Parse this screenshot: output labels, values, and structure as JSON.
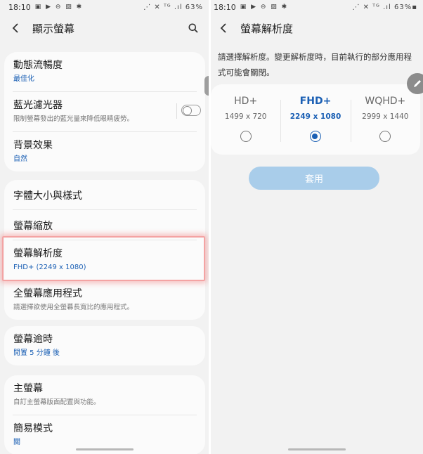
{
  "left": {
    "status": {
      "time": "18:10",
      "icons": "▣ ▶ ⊖ ▨ ✱",
      "right": "⋰ ✕ ᵀᴳ .ıl 63%"
    },
    "title": "顯示螢幕",
    "groups": [
      {
        "items": [
          {
            "title": "動態流暢度",
            "subtitle": "最佳化"
          },
          {
            "title": "藍光濾光器",
            "subtitle": "限制螢幕發出的藍光量來降低眼睛疲勞。"
          },
          {
            "title": "背景效果",
            "subtitle": "自然"
          }
        ]
      },
      {
        "items": [
          {
            "title": "字體大小與樣式"
          },
          {
            "title": "螢幕縮放"
          },
          {
            "title": "螢幕解析度",
            "subtitle": "FHD+ (2249 x 1080)"
          },
          {
            "title": "全螢幕應用程式",
            "subtitle": "請選擇欲使用全螢幕長寬比的應用程式。"
          }
        ]
      },
      {
        "items": [
          {
            "title": "螢幕逾時",
            "subtitle": "閒置 5 分鐘 後"
          }
        ]
      },
      {
        "items": [
          {
            "title": "主螢幕",
            "subtitle": "自訂主螢幕版面配置與功能。"
          },
          {
            "title": "簡易模式",
            "subtitle": "關"
          }
        ]
      }
    ]
  },
  "right": {
    "status": {
      "time": "18:10",
      "icons": "▣ ▶ ⊖ ▨ ✱",
      "right": "⋰ ✕ ᵀᴳ .ıl 63%▪"
    },
    "title": "螢幕解析度",
    "description": "請選擇解析度。變更解析度時，目前執行的部分應用程式可能會關閉。",
    "options": [
      {
        "name": "HD+",
        "dims": "1499 x 720",
        "selected": false
      },
      {
        "name": "FHD+",
        "dims": "2249 x 1080",
        "selected": true
      },
      {
        "name": "WQHD+",
        "dims": "2999 x 1440",
        "selected": false
      }
    ],
    "apply_label": "套用"
  },
  "colors": {
    "accent": "#1a5fb4",
    "apply_bg": "#a9cdea",
    "highlight": "#f4a3a3"
  }
}
